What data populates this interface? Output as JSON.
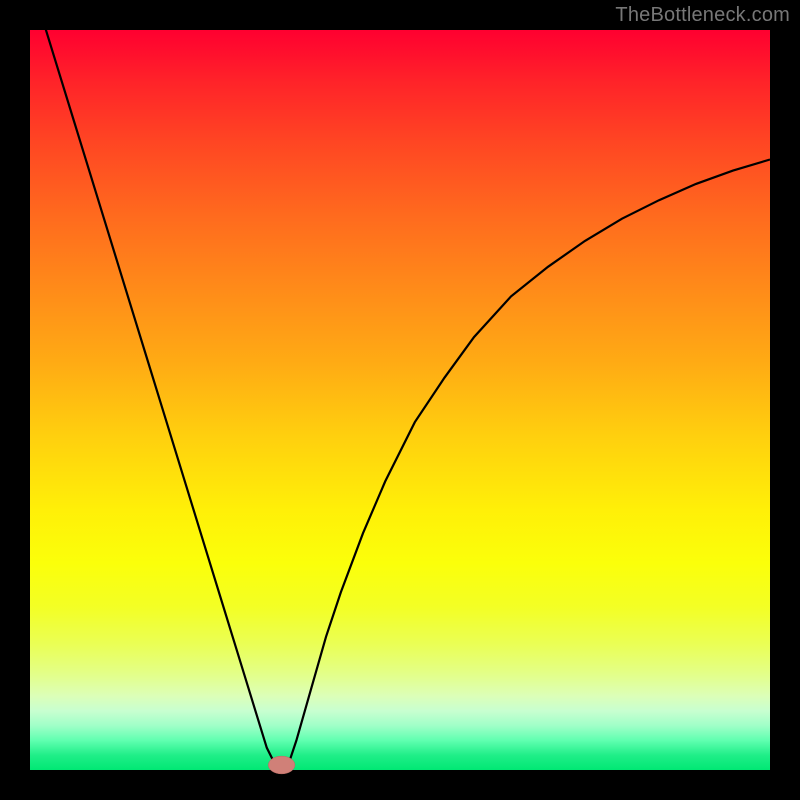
{
  "watermark": "TheBottleneck.com",
  "chart_data": {
    "type": "line",
    "title": "",
    "xlabel": "",
    "ylabel": "",
    "xlim": [
      0,
      100
    ],
    "ylim": [
      0,
      100
    ],
    "x_minimum": 34,
    "series": [
      {
        "name": "curve",
        "x": [
          0,
          2,
          4,
          6,
          8,
          10,
          12,
          14,
          16,
          18,
          20,
          22,
          24,
          26,
          28,
          30,
          32,
          33,
          34,
          35,
          36,
          38,
          40,
          42,
          45,
          48,
          52,
          56,
          60,
          65,
          70,
          75,
          80,
          85,
          90,
          95,
          100
        ],
        "y": [
          107,
          100.5,
          94,
          87.5,
          81,
          74.5,
          68,
          61.5,
          55,
          48.5,
          42,
          35.5,
          29,
          22.5,
          16,
          9.5,
          3,
          1,
          0,
          1,
          4,
          11,
          18,
          24,
          32,
          39,
          47,
          53,
          58.5,
          64,
          68,
          71.5,
          74.5,
          77,
          79.2,
          81,
          82.5
        ]
      }
    ],
    "marker": {
      "x": 34,
      "y": 0,
      "rx": 1.8,
      "ry": 1.2
    },
    "colors": {
      "curve": "#000000",
      "marker": "#d08078",
      "background_top": "#ff0030",
      "background_bottom": "#00e874"
    }
  }
}
